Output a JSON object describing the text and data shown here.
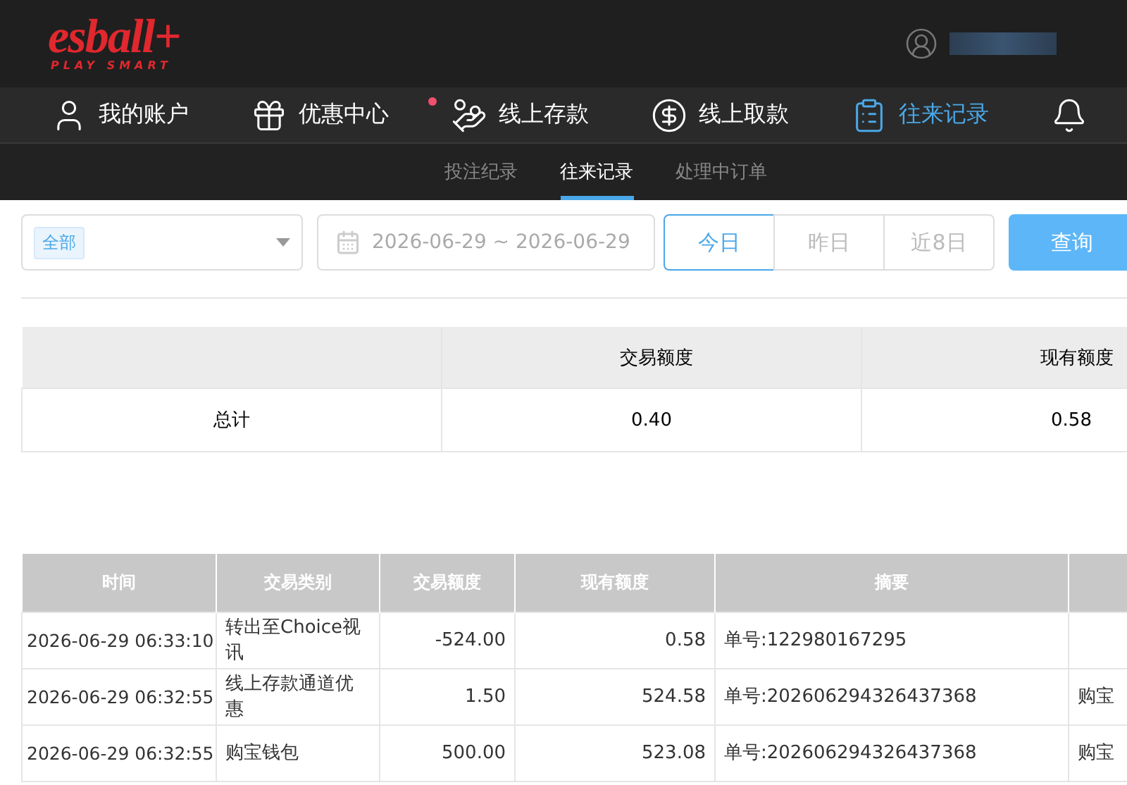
{
  "header": {
    "logo": "esball+",
    "tagline": "PLAY SMART"
  },
  "nav": [
    {
      "kind": "user",
      "label": "我的账户",
      "selected": false,
      "badge": false
    },
    {
      "kind": "gift",
      "label": "优惠中心",
      "selected": false,
      "badge": true
    },
    {
      "kind": "deposit",
      "label": "线上存款",
      "selected": false,
      "badge": false
    },
    {
      "kind": "withdraw",
      "label": "线上取款",
      "selected": false,
      "badge": false
    },
    {
      "kind": "records",
      "label": "往来记录",
      "selected": true,
      "badge": false
    },
    {
      "kind": "bell",
      "selected": false,
      "badge": false
    }
  ],
  "subtabs": [
    {
      "label": "投注纪录",
      "selected": false
    },
    {
      "label": "往来记录",
      "selected": true
    },
    {
      "label": "处理中订单",
      "selected": false
    }
  ],
  "filters": {
    "category_tag": "全部",
    "date_range": "2026-06-29 ~ 2026-06-29",
    "quick_ranges": [
      {
        "label": "今日",
        "selected": true
      },
      {
        "label": "昨日",
        "selected": false
      },
      {
        "label": "近8日",
        "selected": false
      }
    ],
    "query_button": "查询"
  },
  "summary": {
    "columns": [
      "",
      "交易额度",
      "现有额度"
    ],
    "row": [
      "总计",
      "0.40",
      "0.58"
    ]
  },
  "transactions": {
    "columns": [
      "时间",
      "交易类别",
      "交易额度",
      "现有额度",
      "摘要",
      ""
    ],
    "rows": [
      [
        "2026-06-29 06:33:10",
        "转出至Choice视讯",
        "-524.00",
        "0.58",
        "单号:122980167295",
        ""
      ],
      [
        "2026-06-29 06:32:55",
        "线上存款通道优惠",
        "1.50",
        "524.58",
        "单号:202606294326437368",
        "购宝"
      ],
      [
        "2026-06-29 06:32:55",
        "购宝钱包",
        "500.00",
        "523.08",
        "单号:202606294326437368",
        "购宝"
      ]
    ]
  }
}
